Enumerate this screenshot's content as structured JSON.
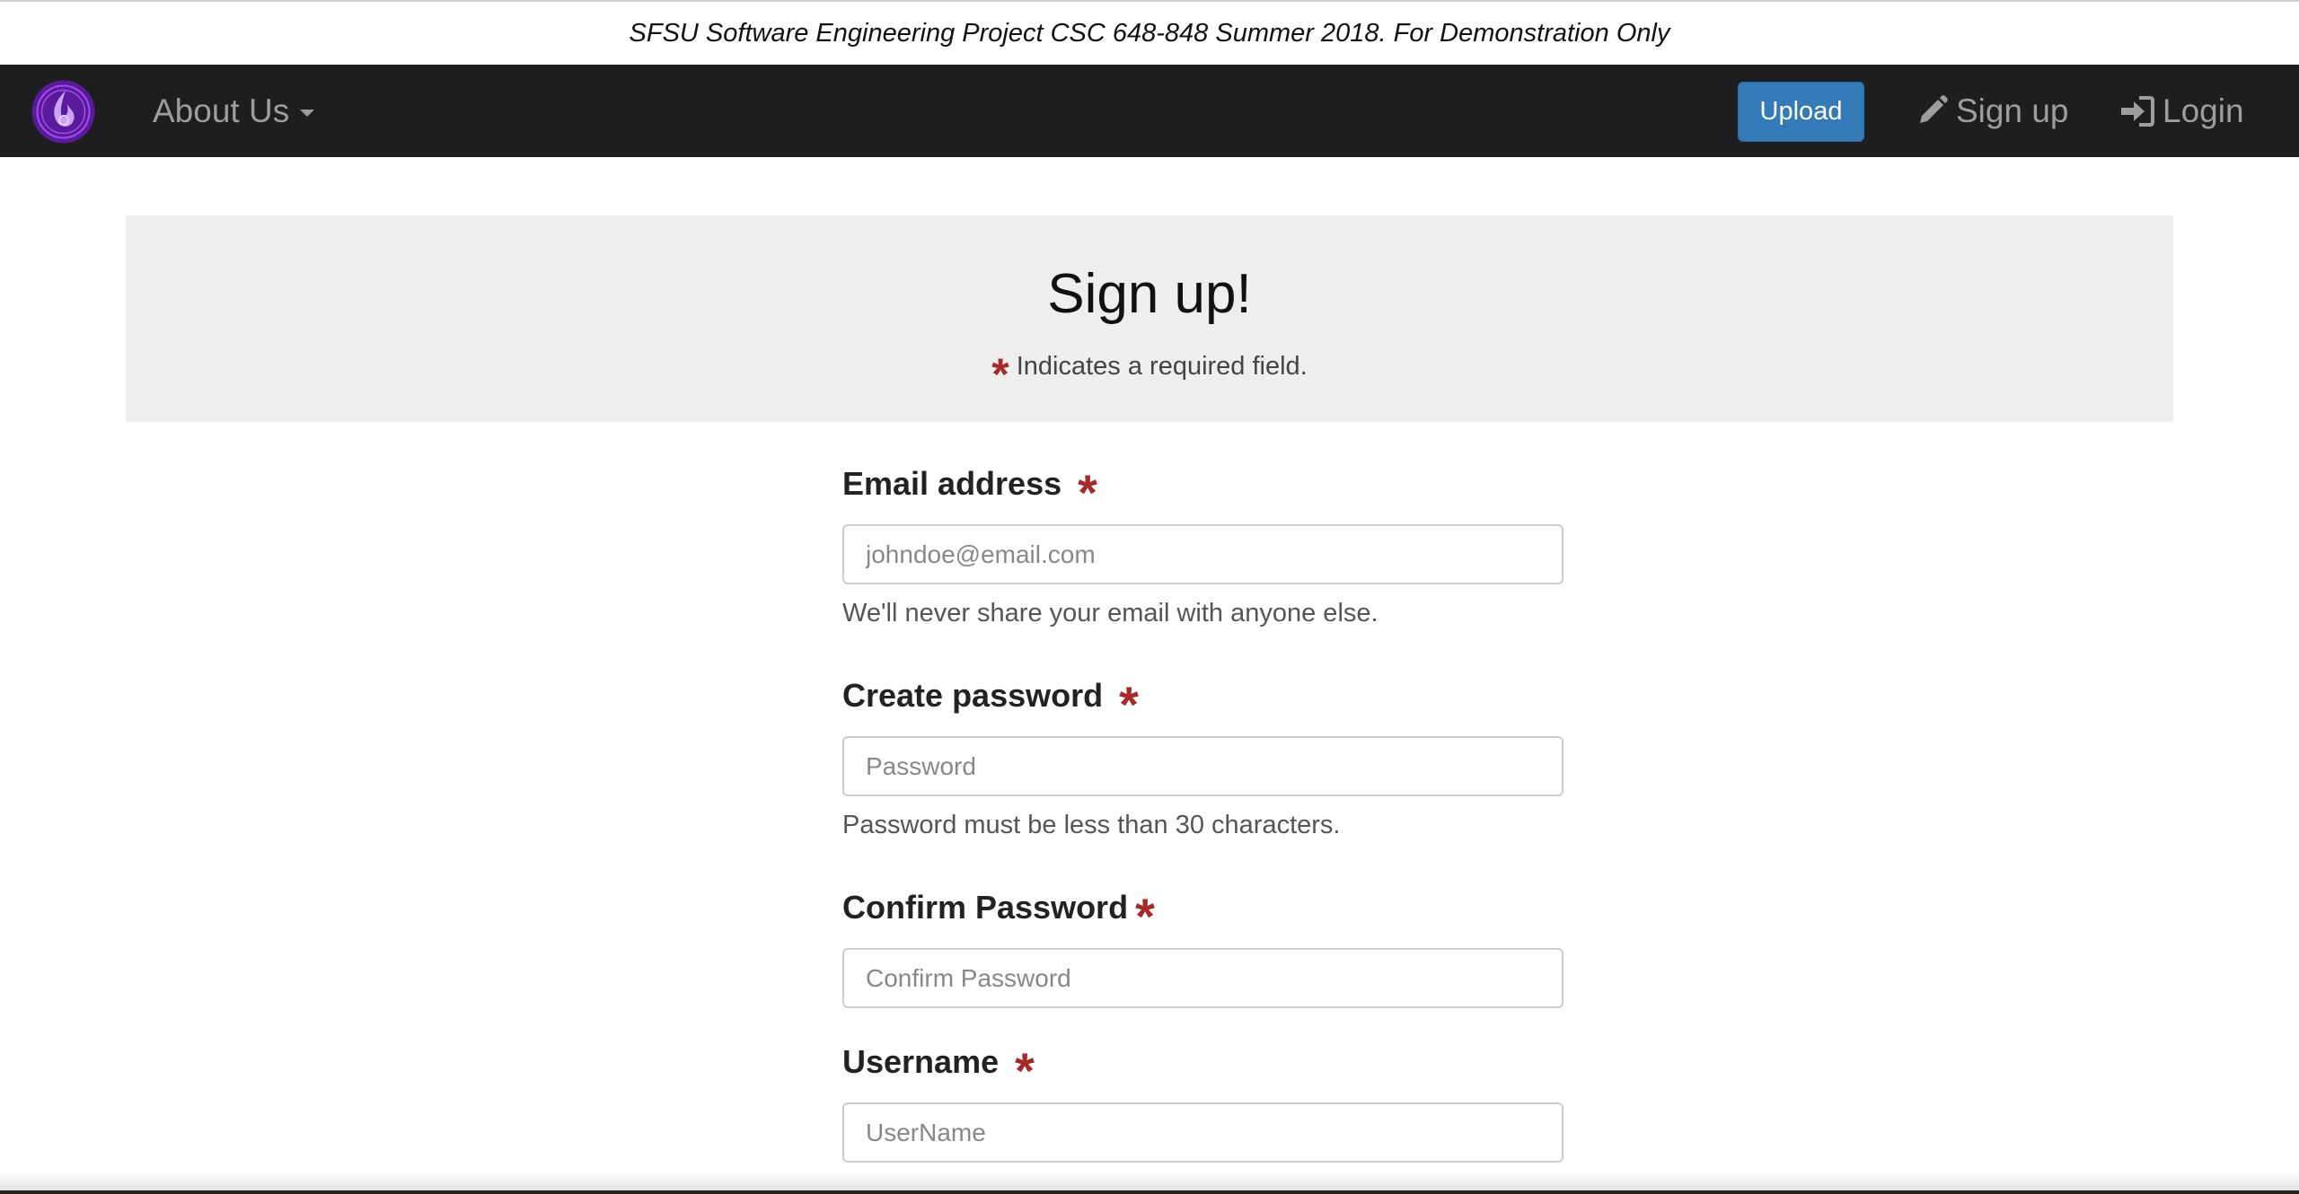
{
  "banner": {
    "text": "SFSU Software Engineering Project CSC 648-848 Summer 2018. For Demonstration Only"
  },
  "navbar": {
    "logo_icon": "flame-logo-icon",
    "about_label": "About Us",
    "upload_label": "Upload",
    "signup_label": "Sign up",
    "login_label": "Login",
    "colors": {
      "background": "#1e1e20",
      "link": "#9d9d9d",
      "upload_button": "#337ab7",
      "logo": "#8a2be2"
    }
  },
  "jumbotron": {
    "title": "Sign up!",
    "required_note": "Indicates a required field.",
    "required_marker": "*"
  },
  "form": {
    "fields": [
      {
        "label": "Email address",
        "placeholder": "johndoe@email.com",
        "value": "",
        "help": "We'll never share your email with anyone else.",
        "required": true
      },
      {
        "label": "Create password",
        "placeholder": "Password",
        "value": "",
        "help": "Password must be less than 30 characters.",
        "required": true
      },
      {
        "label": "Confirm Password",
        "placeholder": "Confirm Password",
        "value": "",
        "required": true
      },
      {
        "label": "Username",
        "placeholder": "UserName",
        "value": "",
        "required": true
      }
    ],
    "required_color": "#a52a2a"
  }
}
